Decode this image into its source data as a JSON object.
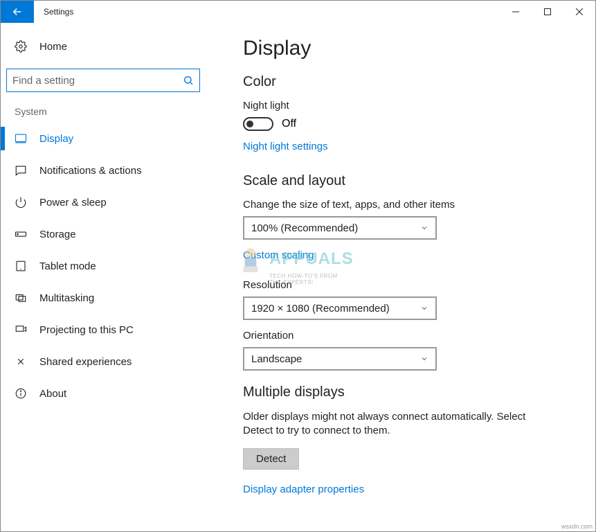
{
  "window": {
    "title": "Settings"
  },
  "sidebar": {
    "home": "Home",
    "search_placeholder": "Find a setting",
    "section": "System",
    "items": [
      {
        "label": "Display",
        "active": true
      },
      {
        "label": "Notifications & actions"
      },
      {
        "label": "Power & sleep"
      },
      {
        "label": "Storage"
      },
      {
        "label": "Tablet mode"
      },
      {
        "label": "Multitasking"
      },
      {
        "label": "Projecting to this PC"
      },
      {
        "label": "Shared experiences"
      },
      {
        "label": "About"
      }
    ]
  },
  "page": {
    "title": "Display",
    "color_heading": "Color",
    "night_light_label": "Night light",
    "night_light_state": "Off",
    "night_light_link": "Night light settings",
    "scale_heading": "Scale and layout",
    "scale_label": "Change the size of text, apps, and other items",
    "scale_value": "100% (Recommended)",
    "custom_scaling_link": "Custom scaling",
    "resolution_label": "Resolution",
    "resolution_value": "1920 × 1080 (Recommended)",
    "orientation_label": "Orientation",
    "orientation_value": "Landscape",
    "multiple_heading": "Multiple displays",
    "multiple_text": "Older displays might not always connect automatically. Select Detect to try to connect to them.",
    "detect_button": "Detect",
    "adapter_link": "Display adapter properties"
  },
  "watermark": {
    "brand": "APPUALS",
    "tag1": "TECH HOW-TO'S FROM",
    "tag2": "THE EXPERTS!"
  },
  "footer": "wsxdn.com"
}
